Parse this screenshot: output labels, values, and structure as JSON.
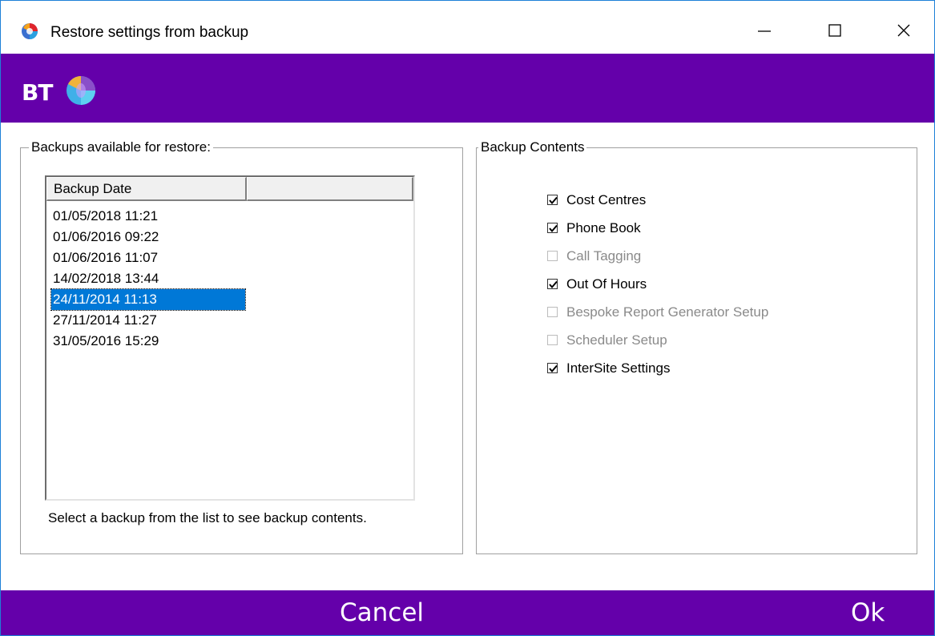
{
  "window": {
    "title": "Restore settings from backup"
  },
  "brand": {
    "logo_text": "BT"
  },
  "backups": {
    "legend": "Backups available for restore:",
    "columns": [
      "Backup Date",
      ""
    ],
    "rows": [
      "01/05/2018 11:21",
      "01/06/2016 09:22",
      "01/06/2016 11:07",
      "14/02/2018 13:44",
      "24/11/2014 11:13",
      "27/11/2014 11:27",
      "31/05/2016 15:29"
    ],
    "selected_row": "24/11/2014 11:13",
    "hint": "Select a backup from the list to see backup contents."
  },
  "contents": {
    "legend": "Backup Contents",
    "items": [
      {
        "label": "Cost Centres",
        "checked": true,
        "enabled": true
      },
      {
        "label": "Phone Book",
        "checked": true,
        "enabled": true
      },
      {
        "label": "Call Tagging",
        "checked": false,
        "enabled": false
      },
      {
        "label": "Out Of Hours",
        "checked": true,
        "enabled": true
      },
      {
        "label": "Bespoke Report Generator Setup",
        "checked": false,
        "enabled": false
      },
      {
        "label": "Scheduler Setup",
        "checked": false,
        "enabled": false
      },
      {
        "label": "InterSite Settings",
        "checked": true,
        "enabled": true
      }
    ]
  },
  "footer": {
    "cancel_label": "Cancel",
    "ok_label": "Ok"
  },
  "colors": {
    "brand_purple": "#6400aa",
    "selection_blue": "#0078d7"
  }
}
